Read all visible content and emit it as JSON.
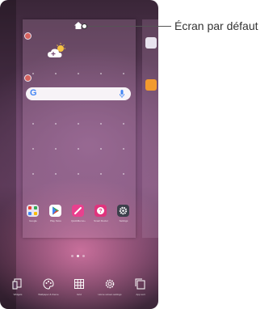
{
  "callout": {
    "label": "Écran par défaut"
  },
  "bottom_bar": {
    "items": [
      {
        "icon": "widgets-icon",
        "label": "Widgets"
      },
      {
        "icon": "wallpaper-theme-icon",
        "label": "Wallpaper & theme"
      },
      {
        "icon": "grid-icon",
        "label": "Grid"
      },
      {
        "icon": "settings-gear-icon",
        "label": "Home screen settings"
      },
      {
        "icon": "app-sort-icon",
        "label": "App sort"
      }
    ]
  },
  "dock": {
    "apps": [
      {
        "icon": "google-folder-icon",
        "label": "Google",
        "color": "#e8e3ee"
      },
      {
        "icon": "play-store-icon",
        "label": "Play Store",
        "color": "#ffffff"
      },
      {
        "icon": "quickmemo-icon",
        "label": "QuickMemo+",
        "color": "#e9408e"
      },
      {
        "icon": "smart-doctor-icon",
        "label": "Smart Doctor",
        "color": "#e0347d"
      },
      {
        "icon": "settings-icon",
        "label": "Settings",
        "color": "#3c3f4b"
      }
    ]
  },
  "search": {
    "logo": "G"
  },
  "colors": {
    "accent": "#e9408e",
    "badge": "#e0533f"
  }
}
